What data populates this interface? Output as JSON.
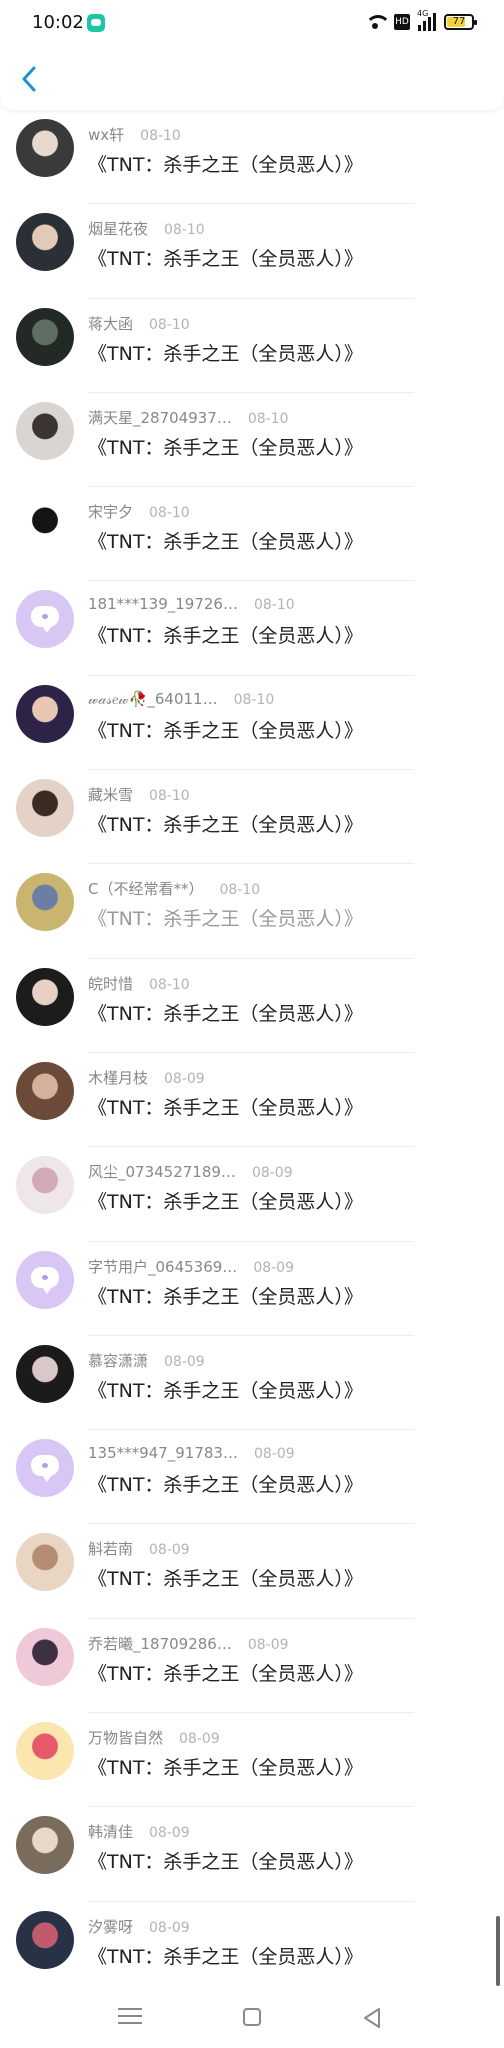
{
  "status_bar": {
    "time": "10:02",
    "signal_label": "4G",
    "battery_level": "77"
  },
  "header": {
    "back_icon": "chevron-left-icon",
    "accent_color": "#1e90d8"
  },
  "list": {
    "items": [
      {
        "name": "wx轩",
        "date": "08-10",
        "book": "《TNT：杀手之王（全员恶人）》",
        "avatar": "photo"
      },
      {
        "name": "烟星花夜",
        "date": "08-10",
        "book": "《TNT：杀手之王（全员恶人）》",
        "avatar": "photo"
      },
      {
        "name": "蒋大函",
        "date": "08-10",
        "book": "《TNT：杀手之王（全员恶人）》",
        "avatar": "photo"
      },
      {
        "name": "满天星_28704937…",
        "date": "08-10",
        "book": "《TNT：杀手之王（全员恶人）》",
        "avatar": "photo"
      },
      {
        "name": "宋宇夕",
        "date": "08-10",
        "book": "《TNT：杀手之王（全员恶人）》",
        "avatar": "photo"
      },
      {
        "name": "181***139_19726…",
        "date": "08-10",
        "book": "《TNT：杀手之王（全员恶人）》",
        "avatar": "default"
      },
      {
        "name": "𝓌𝒶𝓈𝑒𝓌🥀_64011…",
        "date": "08-10",
        "book": "《TNT：杀手之王（全员恶人）》",
        "avatar": "photo"
      },
      {
        "name": "藏米雪",
        "date": "08-10",
        "book": "《TNT：杀手之王（全员恶人）》",
        "avatar": "photo"
      },
      {
        "name": "C（不经常看**）",
        "date": "08-10",
        "book": "《TNT：杀手之王（全员恶人）》",
        "avatar": "photo",
        "dim": true
      },
      {
        "name": "皖时惜",
        "date": "08-10",
        "book": "《TNT：杀手之王（全员恶人）》",
        "avatar": "photo"
      },
      {
        "name": "木槿月枝",
        "date": "08-09",
        "book": "《TNT：杀手之王（全员恶人）》",
        "avatar": "photo"
      },
      {
        "name": "风尘_0734527189…",
        "date": "08-09",
        "book": "《TNT：杀手之王（全员恶人）》",
        "avatar": "photo"
      },
      {
        "name": "字节用户_0645369…",
        "date": "08-09",
        "book": "《TNT：杀手之王（全员恶人）》",
        "avatar": "default"
      },
      {
        "name": "慕容潇潇",
        "date": "08-09",
        "book": "《TNT：杀手之王（全员恶人）》",
        "avatar": "photo"
      },
      {
        "name": "135***947_91783…",
        "date": "08-09",
        "book": "《TNT：杀手之王（全员恶人）》",
        "avatar": "default"
      },
      {
        "name": "斛若南",
        "date": "08-09",
        "book": "《TNT：杀手之王（全员恶人）》",
        "avatar": "photo"
      },
      {
        "name": "乔若曦_18709286…",
        "date": "08-09",
        "book": "《TNT：杀手之王（全员恶人）》",
        "avatar": "photo"
      },
      {
        "name": "万物皆自然",
        "date": "08-09",
        "book": "《TNT：杀手之王（全员恶人）》",
        "avatar": "photo"
      },
      {
        "name": "韩清佳",
        "date": "08-09",
        "book": "《TNT：杀手之王（全员恶人）》",
        "avatar": "photo"
      },
      {
        "name": "汐雾呀",
        "date": "08-09",
        "book": "《TNT：杀手之王（全员恶人）》",
        "avatar": "photo"
      }
    ]
  },
  "bottom_nav": {
    "icons": [
      "menu-icon",
      "home-square-icon",
      "back-triangle-icon"
    ]
  }
}
